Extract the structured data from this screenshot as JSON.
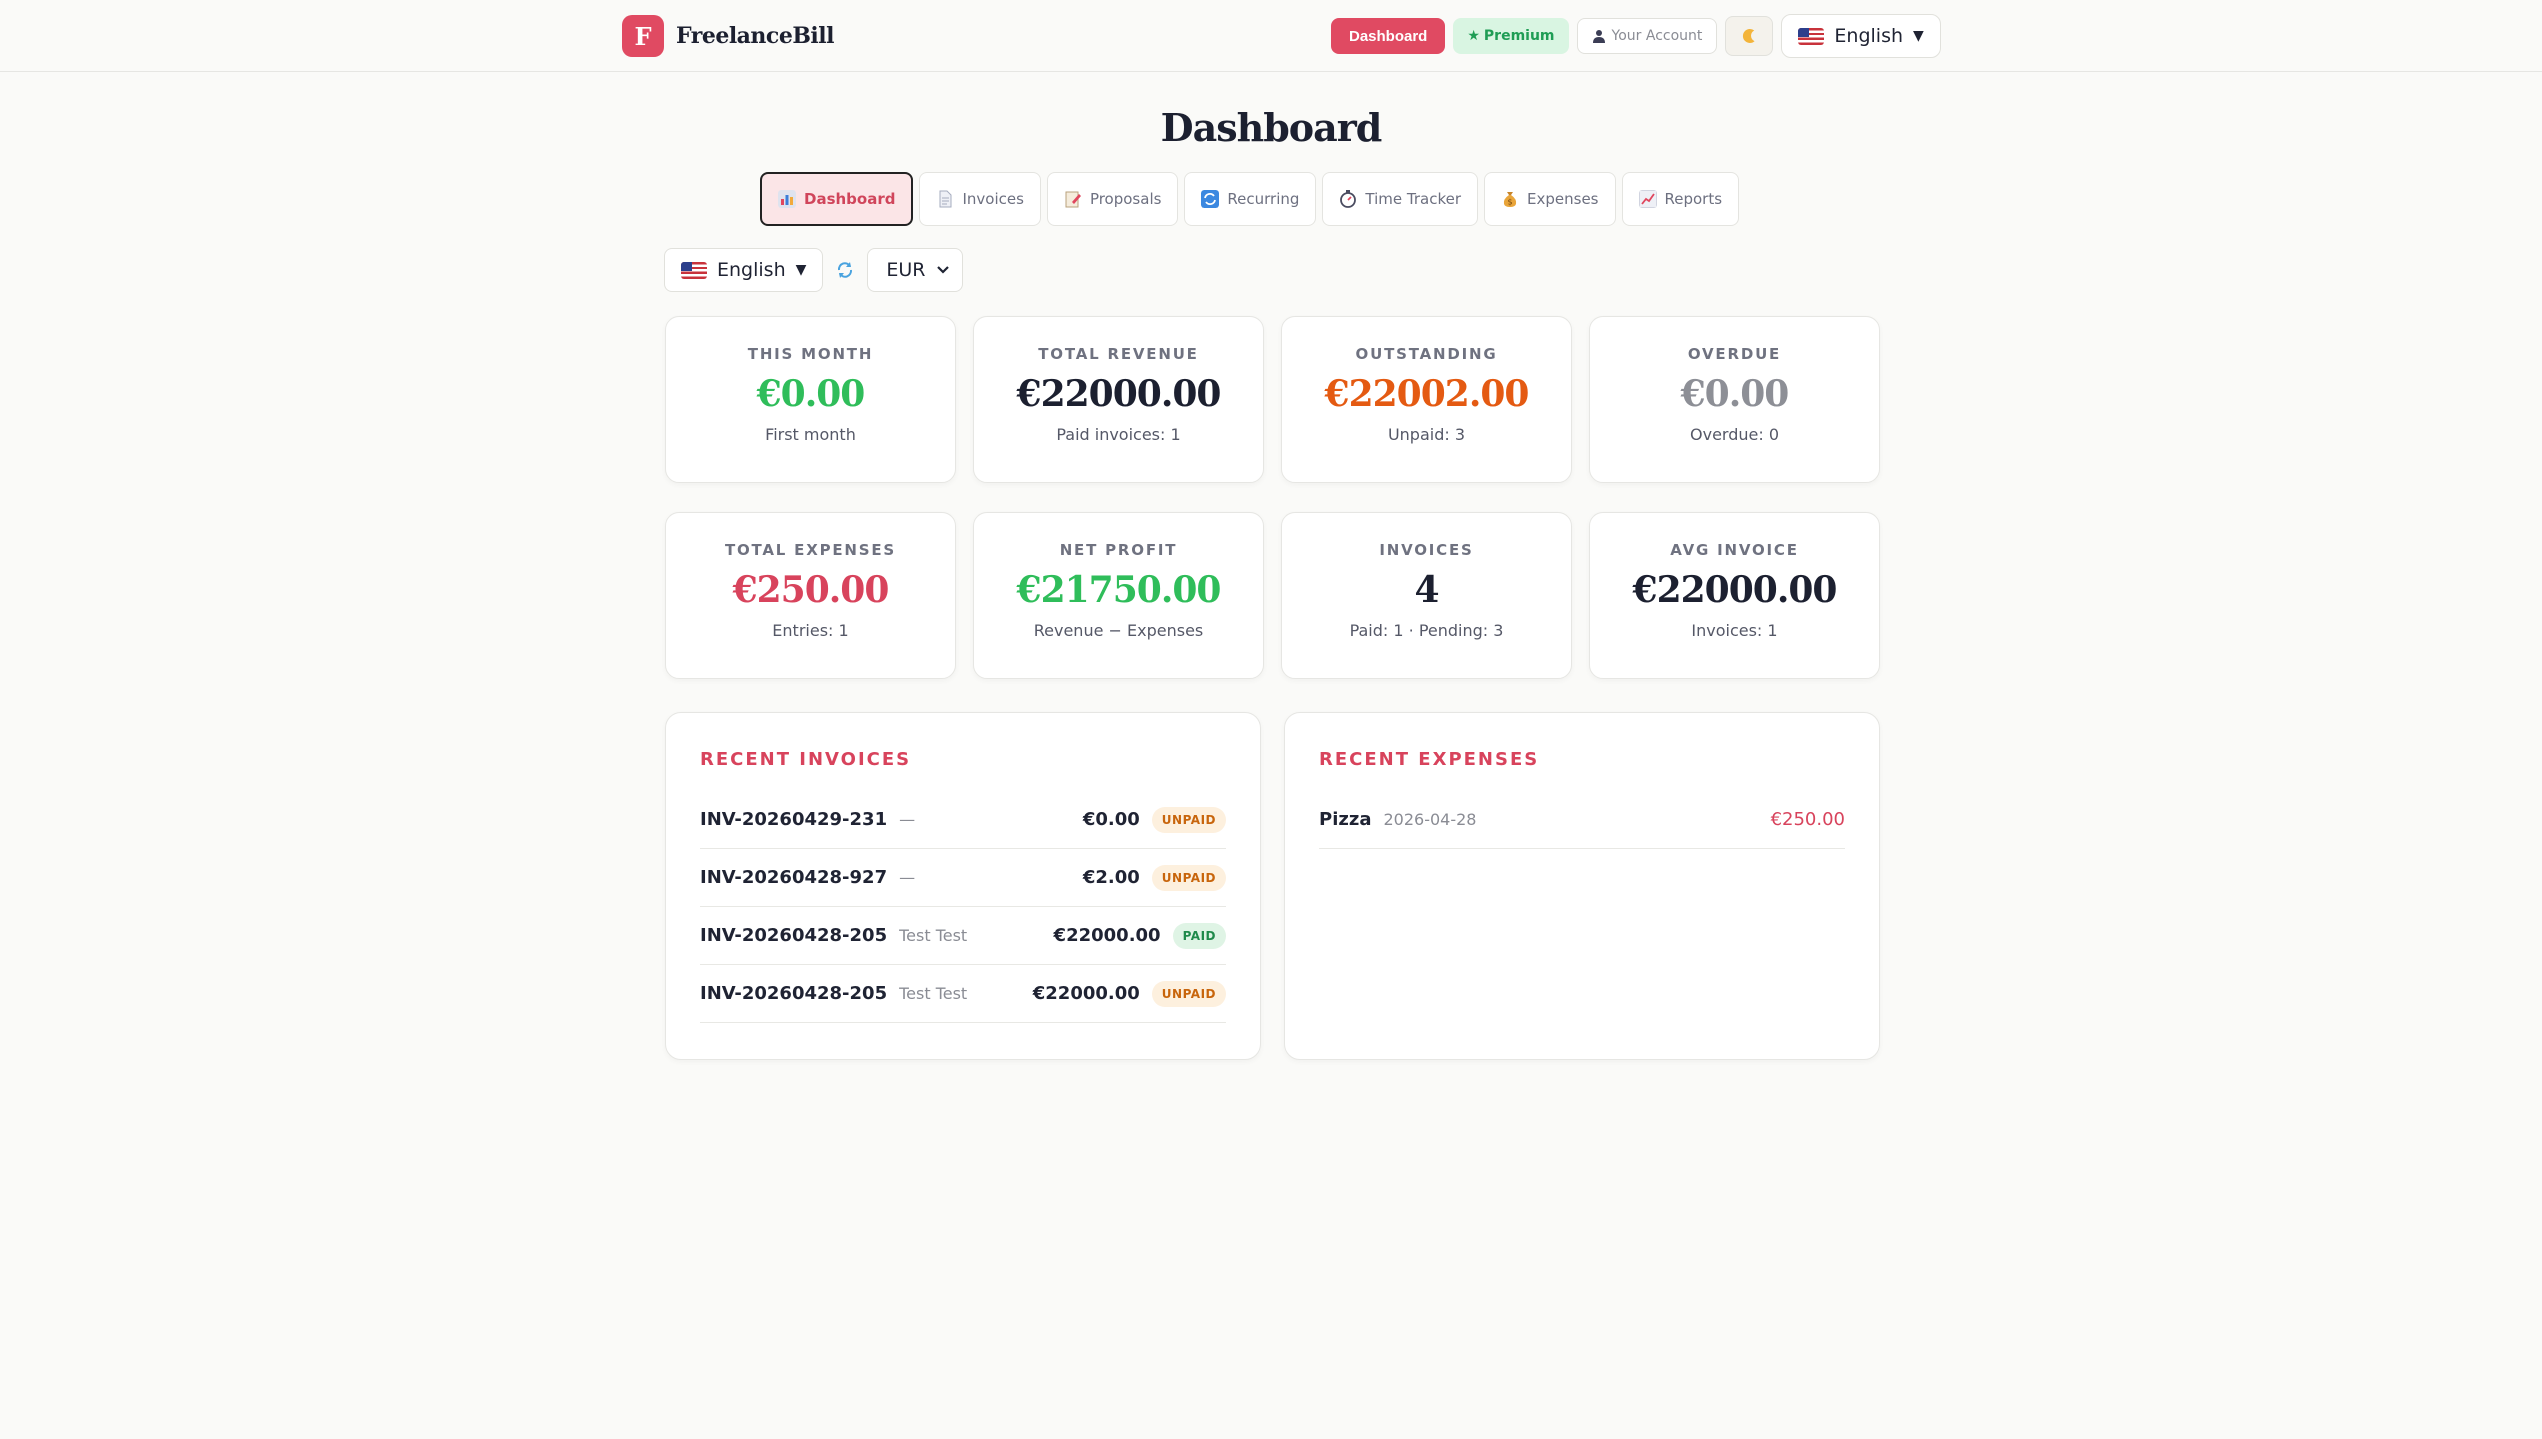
{
  "app": {
    "logo_letter": "F",
    "name": "FreelanceBill"
  },
  "header": {
    "dashboard_label": "Dashboard",
    "premium_label": "Premium",
    "account_label": "Your Account",
    "language": "English"
  },
  "page_title": "Dashboard",
  "tabs": [
    {
      "label": "Dashboard",
      "icon": "bar-chart-icon",
      "active": true
    },
    {
      "label": "Invoices",
      "icon": "document-icon"
    },
    {
      "label": "Proposals",
      "icon": "memo-icon"
    },
    {
      "label": "Recurring",
      "icon": "repeat-icon"
    },
    {
      "label": "Time Tracker",
      "icon": "stopwatch-icon"
    },
    {
      "label": "Expenses",
      "icon": "money-bag-icon"
    },
    {
      "label": "Reports",
      "icon": "trend-chart-icon"
    }
  ],
  "controls": {
    "language": "English",
    "currency": "EUR"
  },
  "stats": [
    {
      "label": "THIS MONTH",
      "value": "€0.00",
      "sub": "First month",
      "color": "#2fbd5a"
    },
    {
      "label": "TOTAL REVENUE",
      "value": "€22000.00",
      "sub": "Paid invoices: 1",
      "color": "#1c2030"
    },
    {
      "label": "OUTSTANDING",
      "value": "€22002.00",
      "sub": "Unpaid: 3",
      "color": "#e45a12"
    },
    {
      "label": "OVERDUE",
      "value": "€0.00",
      "sub": "Overdue: 0",
      "color": "#8d8f96"
    },
    {
      "label": "TOTAL EXPENSES",
      "value": "€250.00",
      "sub": "Entries: 1",
      "color": "#d8435c"
    },
    {
      "label": "NET PROFIT",
      "value": "€21750.00",
      "sub": "Revenue − Expenses",
      "color": "#2fbd5a"
    },
    {
      "label": "INVOICES",
      "value": "4",
      "sub": "Paid: 1 · Pending: 3",
      "color": "#1c2030"
    },
    {
      "label": "AVG INVOICE",
      "value": "€22000.00",
      "sub": "Invoices: 1",
      "color": "#1c2030"
    }
  ],
  "recent_invoices": {
    "title": "RECENT INVOICES",
    "rows": [
      {
        "id": "INV-20260429-231",
        "client": "—",
        "amount": "€0.00",
        "status": "UNPAID"
      },
      {
        "id": "INV-20260428-927",
        "client": "—",
        "amount": "€2.00",
        "status": "UNPAID"
      },
      {
        "id": "INV-20260428-205",
        "client": "Test Test",
        "amount": "€22000.00",
        "status": "PAID"
      },
      {
        "id": "INV-20260428-205",
        "client": "Test Test",
        "amount": "€22000.00",
        "status": "UNPAID"
      }
    ]
  },
  "recent_expenses": {
    "title": "RECENT EXPENSES",
    "rows": [
      {
        "name": "Pizza",
        "date": "2026-04-28",
        "amount": "€250.00"
      }
    ]
  }
}
